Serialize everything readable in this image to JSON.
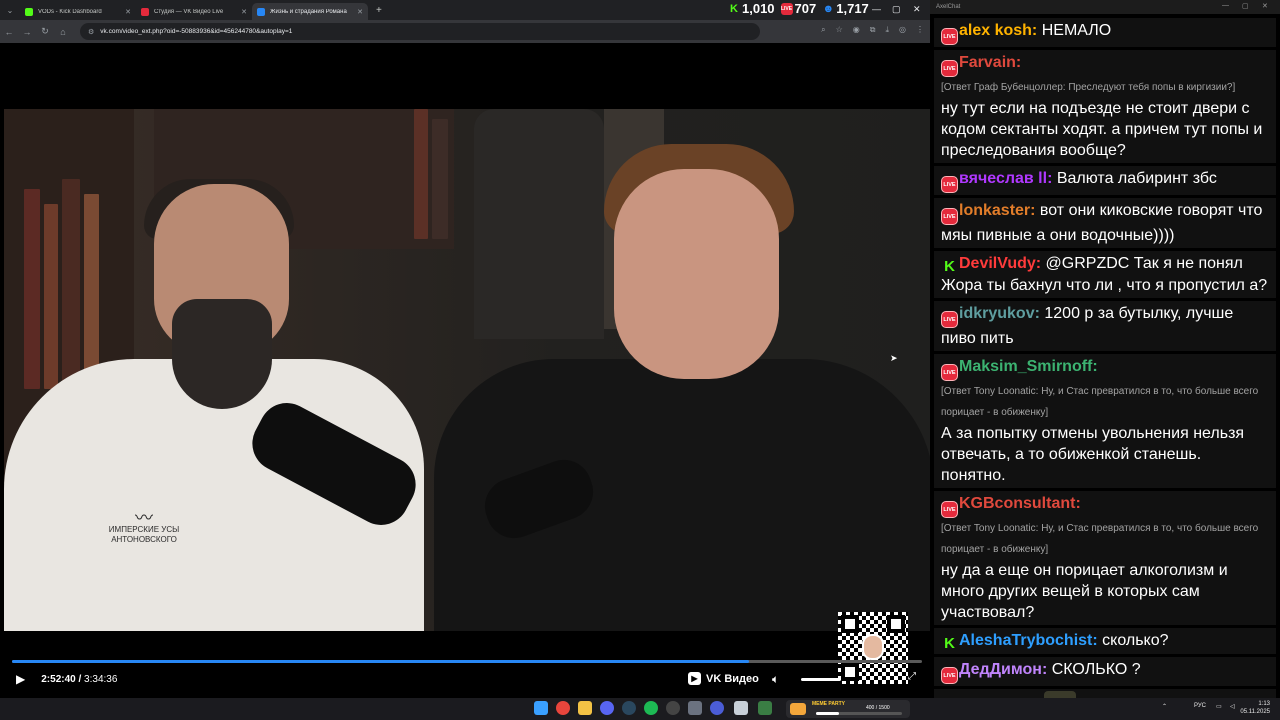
{
  "browser": {
    "tabs": [
      {
        "title": "VODs - Kick Dashboard",
        "favicon_color": "#53fc18",
        "active": false
      },
      {
        "title": "Студия — VK Видео Live",
        "favicon_color": "#e42a3c",
        "active": false
      },
      {
        "title": "Жизнь и страдания Романа",
        "favicon_color": "#2787f5",
        "active": true
      }
    ],
    "url": "vk.com/video_ext.php?oid=-50883936&id=456244780&autoplay=1"
  },
  "stream_stats": {
    "kick_viewers": "1,010",
    "vk_viewers": "707",
    "total_viewers": "1,717",
    "kick_icon": "kick-logo-icon",
    "vk_icon": "vk-live-icon",
    "total_icon": "person-icon"
  },
  "video": {
    "shirt_logo_text": "ИМПЕРСКИЕ УСЫ АНТОНОВСКОГО",
    "current_time": "2:52:40",
    "separator": " / ",
    "duration": "3:34:36",
    "progress_fraction": 0.81,
    "brand": "VK Видео"
  },
  "chat": {
    "window_title": "AxelChat",
    "messages": [
      {
        "platform": "vk",
        "username": "alex kosh:",
        "color": "#ffb300",
        "reply": "",
        "text": "НЕМАЛО"
      },
      {
        "platform": "vk",
        "username": "Farvain:",
        "color": "#e0493d",
        "reply": "[Ответ Граф Бубенцоллер: Преследуют тебя попы в киргизии?]",
        "text": "ну тут если на подъезде не стоит двери с кодом сектанты ходят. а причем тут попы и преследования вообще?"
      },
      {
        "platform": "vk",
        "username": "вячеслав ll:",
        "color": "#b038ff",
        "reply": "",
        "text": "Валюта лабиринт збс"
      },
      {
        "platform": "vk",
        "username": "lonkaster:",
        "color": "#e27d2a",
        "reply": "",
        "text": "вот они киковские говорят что мяы пивные а они водочные))))"
      },
      {
        "platform": "kick",
        "username": "DevilVudy:",
        "color": "#ff3b3b",
        "reply": "",
        "text": "@GRPZDC Так я не понял Жора ты бахнул что ли , что я пропустил а?"
      },
      {
        "platform": "vk",
        "username": "idkryukov:",
        "color": "#5f9ea0",
        "reply": "",
        "text": "1200 р за бутылку, лучше пиво пить"
      },
      {
        "platform": "vk",
        "username": "Maksim_Smirnoff:",
        "color": "#3cb371",
        "reply": "[Ответ Tony Loonatic: Ну, и Стас превратился в то, что больше всего порицает - в обиженку]",
        "text": "А за попытку отмены увольнения нельзя отвечать, а то обиженкой станешь. понятно."
      },
      {
        "platform": "vk",
        "username": "KGBconsultant:",
        "color": "#e0493d",
        "reply": "[Ответ Tony Loonatic: Ну, и Стас превратился в то, что больше всего порицает - в обиженку]",
        "text": "ну да а еще он порицает алкоголизм и много других вещей в которых сам участвовал?"
      },
      {
        "platform": "kick",
        "username": "AleshaTrybochist:",
        "color": "#2e9fff",
        "reply": "",
        "text": "сколько?"
      },
      {
        "platform": "vk",
        "username": "ДедДимон:",
        "color": "#c084fc",
        "reply": "",
        "text": "СКОЛЬКО ?"
      },
      {
        "platform": "vk",
        "username": "idkryukov:",
        "color": "#5f9ea0",
        "reply": "",
        "text": "",
        "emote": true
      }
    ]
  },
  "taskbar": {
    "widget_title": "MEME PARTY",
    "widget_count": "400 / 1500",
    "widget_fraction": 0.27,
    "language": "РУС",
    "time": "1:13",
    "date": "05.11.2025"
  }
}
